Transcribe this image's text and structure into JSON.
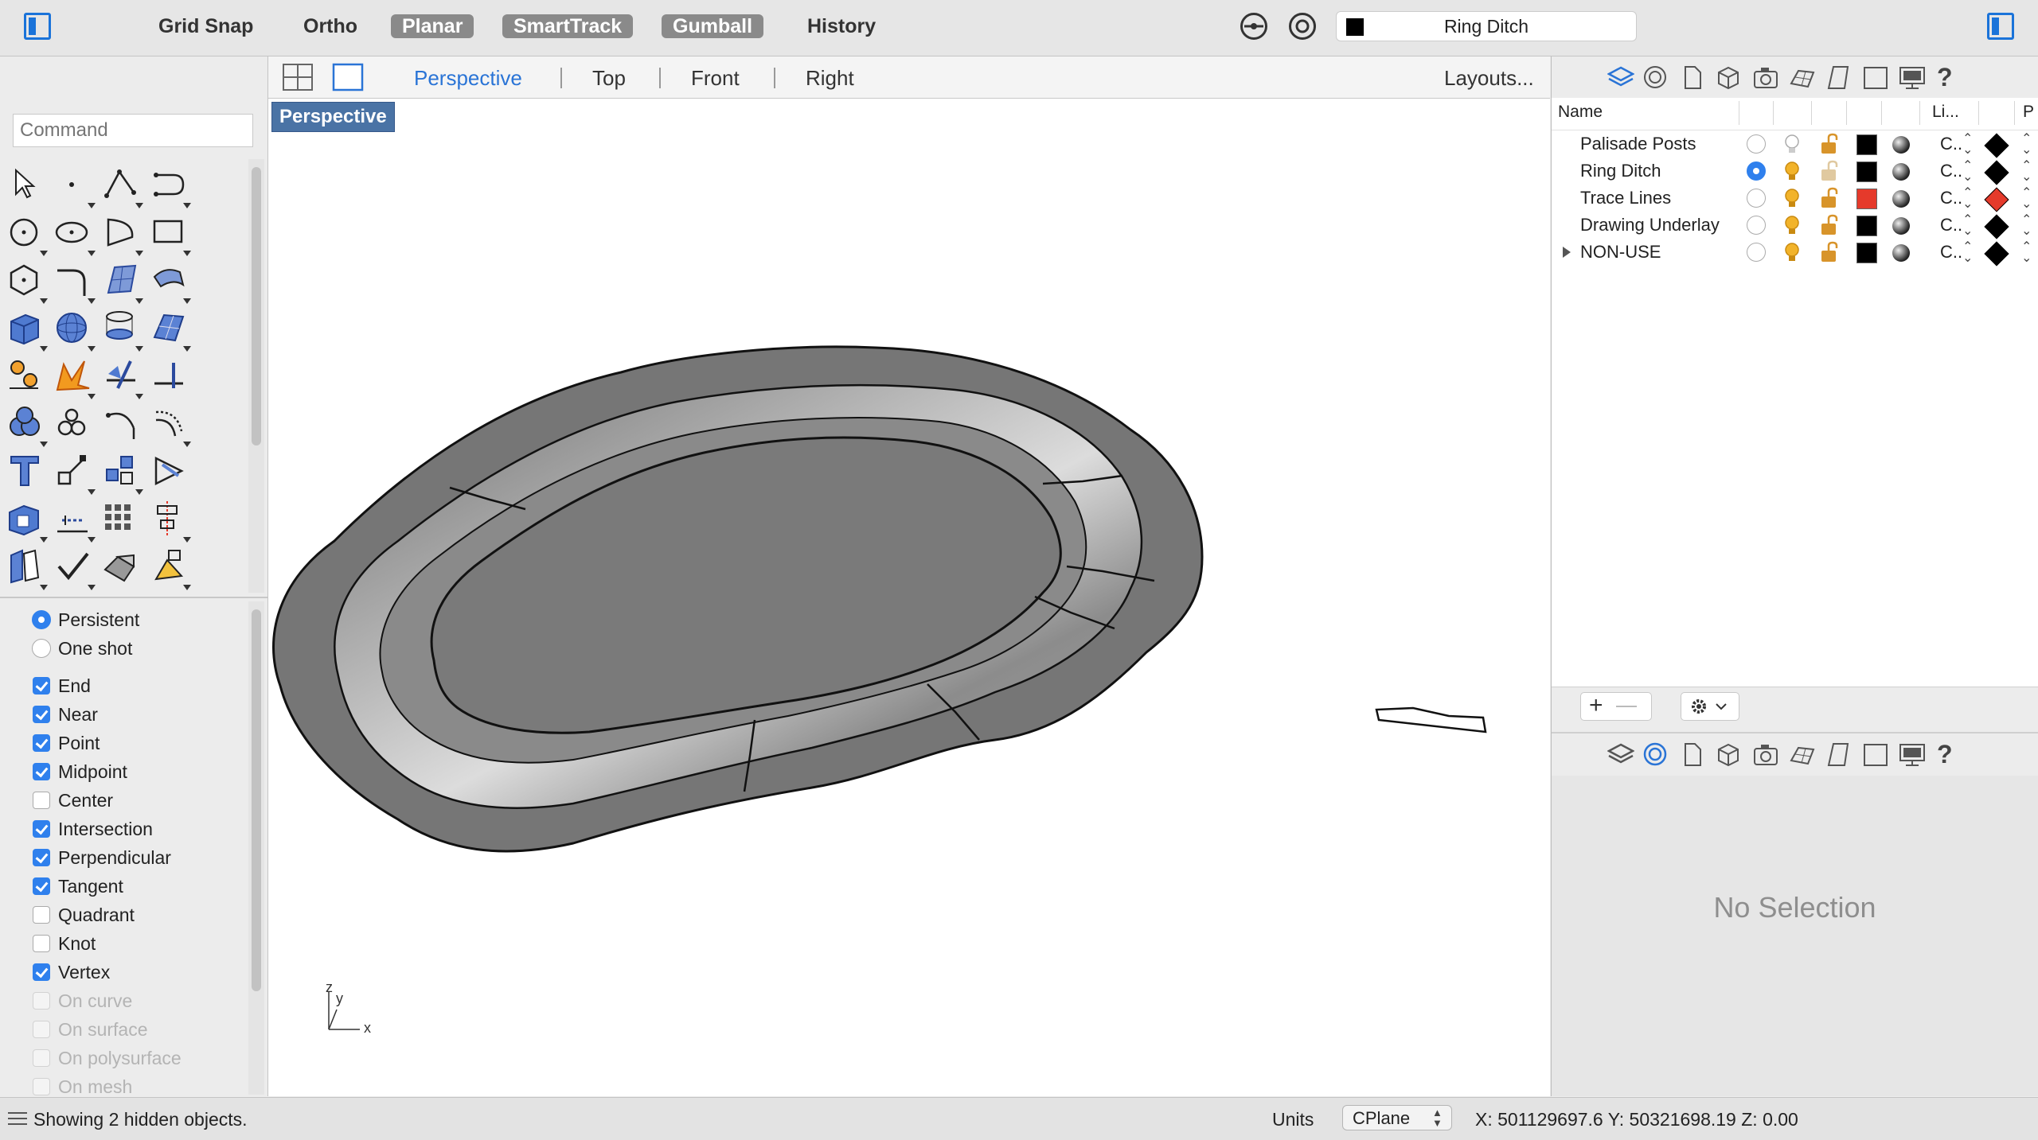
{
  "toolbar": {
    "panel_toggle_icon": "left-panel-icon",
    "modes": [
      {
        "label": "Grid Snap",
        "on": false
      },
      {
        "label": "Ortho",
        "on": false
      },
      {
        "label": "Planar",
        "on": true
      },
      {
        "label": "SmartTrack",
        "on": true
      },
      {
        "label": "Gumball",
        "on": true
      },
      {
        "label": "History",
        "on": false
      }
    ],
    "current_layer": "Ring Ditch",
    "current_layer_color": "#000000"
  },
  "sidebar": {
    "command_placeholder": "Command",
    "osnap_mode": {
      "persistent": "Persistent",
      "one_shot": "One shot",
      "selected": "Persistent"
    },
    "osnaps": [
      {
        "label": "End",
        "checked": true,
        "enabled": true
      },
      {
        "label": "Near",
        "checked": true,
        "enabled": true
      },
      {
        "label": "Point",
        "checked": true,
        "enabled": true
      },
      {
        "label": "Midpoint",
        "checked": true,
        "enabled": true
      },
      {
        "label": "Center",
        "checked": false,
        "enabled": true
      },
      {
        "label": "Intersection",
        "checked": true,
        "enabled": true
      },
      {
        "label": "Perpendicular",
        "checked": true,
        "enabled": true
      },
      {
        "label": "Tangent",
        "checked": true,
        "enabled": true
      },
      {
        "label": "Quadrant",
        "checked": false,
        "enabled": true
      },
      {
        "label": "Knot",
        "checked": false,
        "enabled": true
      },
      {
        "label": "Vertex",
        "checked": true,
        "enabled": true
      },
      {
        "label": "On curve",
        "checked": false,
        "enabled": false
      },
      {
        "label": "On surface",
        "checked": false,
        "enabled": false
      },
      {
        "label": "On polysurface",
        "checked": false,
        "enabled": false
      },
      {
        "label": "On mesh",
        "checked": false,
        "enabled": false
      }
    ]
  },
  "viewport": {
    "tabs": [
      "Perspective",
      "Top",
      "Front",
      "Right"
    ],
    "active_tab": "Perspective",
    "layouts_label": "Layouts...",
    "label": "Perspective",
    "axes": {
      "x": "x",
      "y": "y",
      "z": "z"
    }
  },
  "layers": {
    "columns": {
      "name": "Name",
      "linetype": "Li...",
      "print": "P"
    },
    "rows": [
      {
        "name": "Palisade Posts",
        "current": false,
        "visible": false,
        "locked": false,
        "color": "#000000",
        "linetype": "C..",
        "print_color": "#000000"
      },
      {
        "name": "Ring Ditch",
        "current": true,
        "visible": true,
        "locked": false,
        "color": "#000000",
        "linetype": "C..",
        "print_color": "#000000"
      },
      {
        "name": "Trace Lines",
        "current": false,
        "visible": true,
        "locked": false,
        "color": "#e53a2b",
        "linetype": "C..",
        "print_color": "#e53a2b"
      },
      {
        "name": "Drawing Underlay",
        "current": false,
        "visible": true,
        "locked": false,
        "color": "#000000",
        "linetype": "C..",
        "print_color": "#000000"
      },
      {
        "name": "NON-USE",
        "current": false,
        "visible": true,
        "locked": false,
        "color": "#000000",
        "linetype": "C..",
        "print_color": "#000000",
        "has_children": true
      }
    ]
  },
  "properties": {
    "empty_text": "No Selection"
  },
  "statusbar": {
    "message": "Showing 2 hidden objects.",
    "units_label": "Units",
    "cplane_label": "CPlane",
    "coords": "X: 501129697.6 Y: 50321698.19  Z: 0.00"
  }
}
